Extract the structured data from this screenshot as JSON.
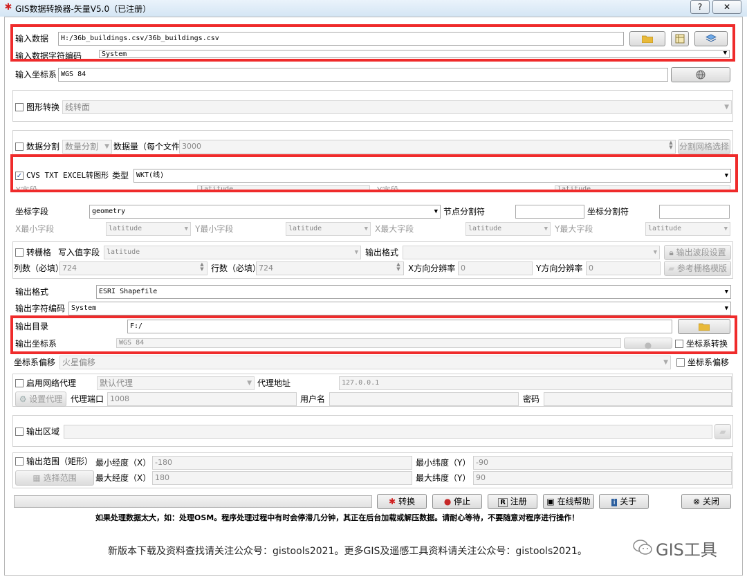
{
  "window": {
    "title": "GIS数据转换器-矢量V5.0（已注册）",
    "help_button": "?",
    "close_button": "✕"
  },
  "input": {
    "data_label": "输入数据",
    "data_value": "H:/36b_buildings.csv/36b_buildings.csv",
    "encoding_label": "输入数据字符编码",
    "encoding_value": "System",
    "crs_label": "输入坐标系",
    "crs_value": "WGS 84"
  },
  "shape_convert": {
    "label": "图形转换",
    "value": "线转面"
  },
  "split": {
    "label": "数据分割",
    "mode": "数量分割",
    "count_label": "数据量（每个文件",
    "count_value": "3000",
    "grid_button": "分割网格选择"
  },
  "csv_convert": {
    "label": "CVS TXT EXCEL转图形",
    "type_label": "类型",
    "type_value": "WKT(线)",
    "x_label": "X字段",
    "x_value": "latitude",
    "y_label": "Y字段",
    "y_value": "latitude",
    "coord_field_label": "坐标字段",
    "coord_field_value": "geometry",
    "node_sep_label": "节点分割符",
    "node_sep_value": "",
    "coord_sep_label": "坐标分割符",
    "coord_sep_value": "",
    "xmin_label": "X最小字段",
    "xmin_value": "latitude",
    "ymin_label": "Y最小字段",
    "ymin_value": "latitude",
    "xmax_label": "X最大字段",
    "xmax_value": "latitude",
    "ymax_label": "Y最大字段",
    "ymax_value": "latitude"
  },
  "raster": {
    "label": "转栅格",
    "write_field_label": "写入值字段",
    "write_field_value": "latitude",
    "format_label": "输出格式",
    "format_value": "",
    "band_button": "输出波段设置",
    "cols_label": "列数（必填）",
    "cols_value": "724",
    "rows_label": "行数（必填）",
    "rows_value": "724",
    "xres_label": "X方向分辨率",
    "xres_value": "0",
    "yres_label": "Y方向分辨率",
    "yres_value": "0",
    "ref_button": "参考栅格模版"
  },
  "output": {
    "format_label": "输出格式",
    "format_value": "ESRI Shapefile",
    "encoding_label": "输出字符编码",
    "encoding_value": "System",
    "dir_label": "输出目录",
    "dir_value": "F:/",
    "crs_label": "输出坐标系",
    "crs_value": "WGS 84",
    "crs_convert_label": "坐标系转换",
    "offset_label": "坐标系偏移",
    "offset_value": "火星偏移",
    "offset_check_label": "坐标系偏移"
  },
  "proxy": {
    "label": "启用网络代理",
    "mode": "默认代理",
    "address_label": "代理地址",
    "address_value": "127.0.0.1",
    "settings_button": "设置代理",
    "port_label": "代理端口",
    "port_value": "1008",
    "user_label": "用户名",
    "user_value": "",
    "password_label": "密码",
    "password_value": ""
  },
  "region": {
    "label": "输出区域",
    "value": ""
  },
  "extent": {
    "label": "输出范围（矩形）",
    "min_lon_label": "最小经度（X）",
    "min_lon_value": "-180",
    "min_lat_label": "最小纬度（Y）",
    "min_lat_value": "-90",
    "select_button": "选择范围",
    "max_lon_label": "最大经度（X）",
    "max_lon_value": "180",
    "max_lat_label": "最大纬度（Y）",
    "max_lat_value": "90"
  },
  "actions": {
    "convert": "转换",
    "stop": "停止",
    "register": "注册",
    "help": "在线帮助",
    "about": "关于",
    "close": "关闭"
  },
  "notice": "如果处理数据太大，如：处理OSM。程序处理过程中有时会停滞几分钟，其正在后台加载或解压数据。请耐心等待，不要随意对程序进行操作！",
  "footer": "新版本下载及资料查找请关注公众号：gistools2021。更多GIS及遥感工具资料请关注公众号：gistools2021。",
  "watermark": "GIS工具",
  "colors": {
    "highlight": "#ef2b2b",
    "folder": "#e8b93a"
  }
}
